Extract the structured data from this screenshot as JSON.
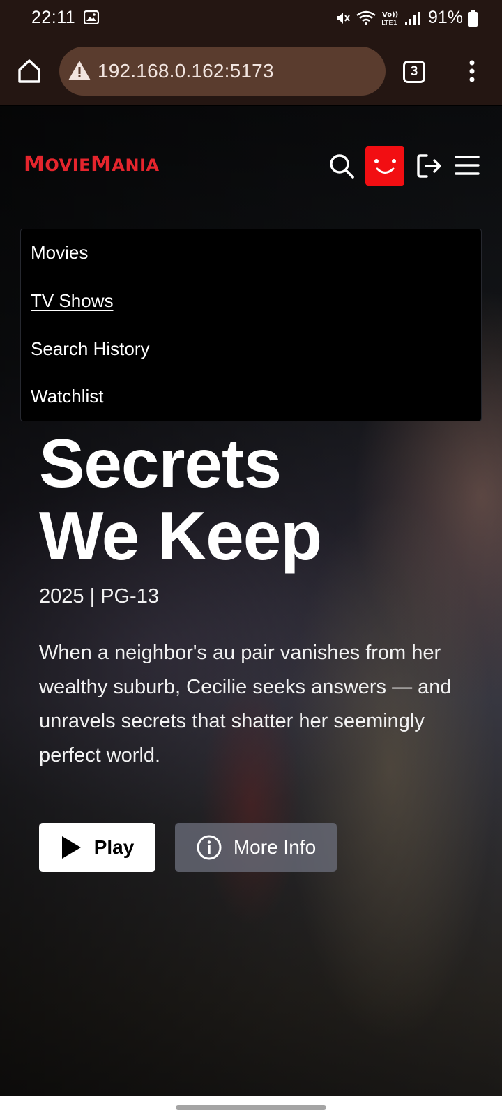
{
  "status_bar": {
    "time": "22:11",
    "battery": "91%",
    "icons": [
      "gallery-icon",
      "mute-icon",
      "wifi-icon",
      "volte-icon",
      "signal-icon",
      "battery-icon"
    ]
  },
  "browser": {
    "url": "192.168.0.162:5173",
    "tab_count": "3",
    "icons": [
      "home-icon",
      "warning-icon",
      "tabs-icon",
      "more-vert-icon"
    ]
  },
  "site": {
    "logo": {
      "first_big": "M",
      "first_small": "OVIE",
      "second_big": "M",
      "second_small": "ANIA"
    },
    "header_icons": [
      "search-icon",
      "profile-avatar",
      "logout-icon",
      "hamburger-menu-icon"
    ],
    "accent_color": "#e5252d",
    "avatar_color": "#f20e12"
  },
  "menu": {
    "items": [
      {
        "label": "Movies"
      },
      {
        "label": "TV Shows"
      },
      {
        "label": "Search History"
      },
      {
        "label": "Watchlist"
      }
    ]
  },
  "hero": {
    "title_line1": "Secrets",
    "title_line2": "We Keep",
    "meta": "2025 | PG-13",
    "description": "When a neighbor's au pair vanishes from her wealthy suburb, Cecilie seeks answers — and unravels secrets that shatter her seemingly perfect world.",
    "play_label": "Play",
    "more_info_label": "More Info"
  }
}
